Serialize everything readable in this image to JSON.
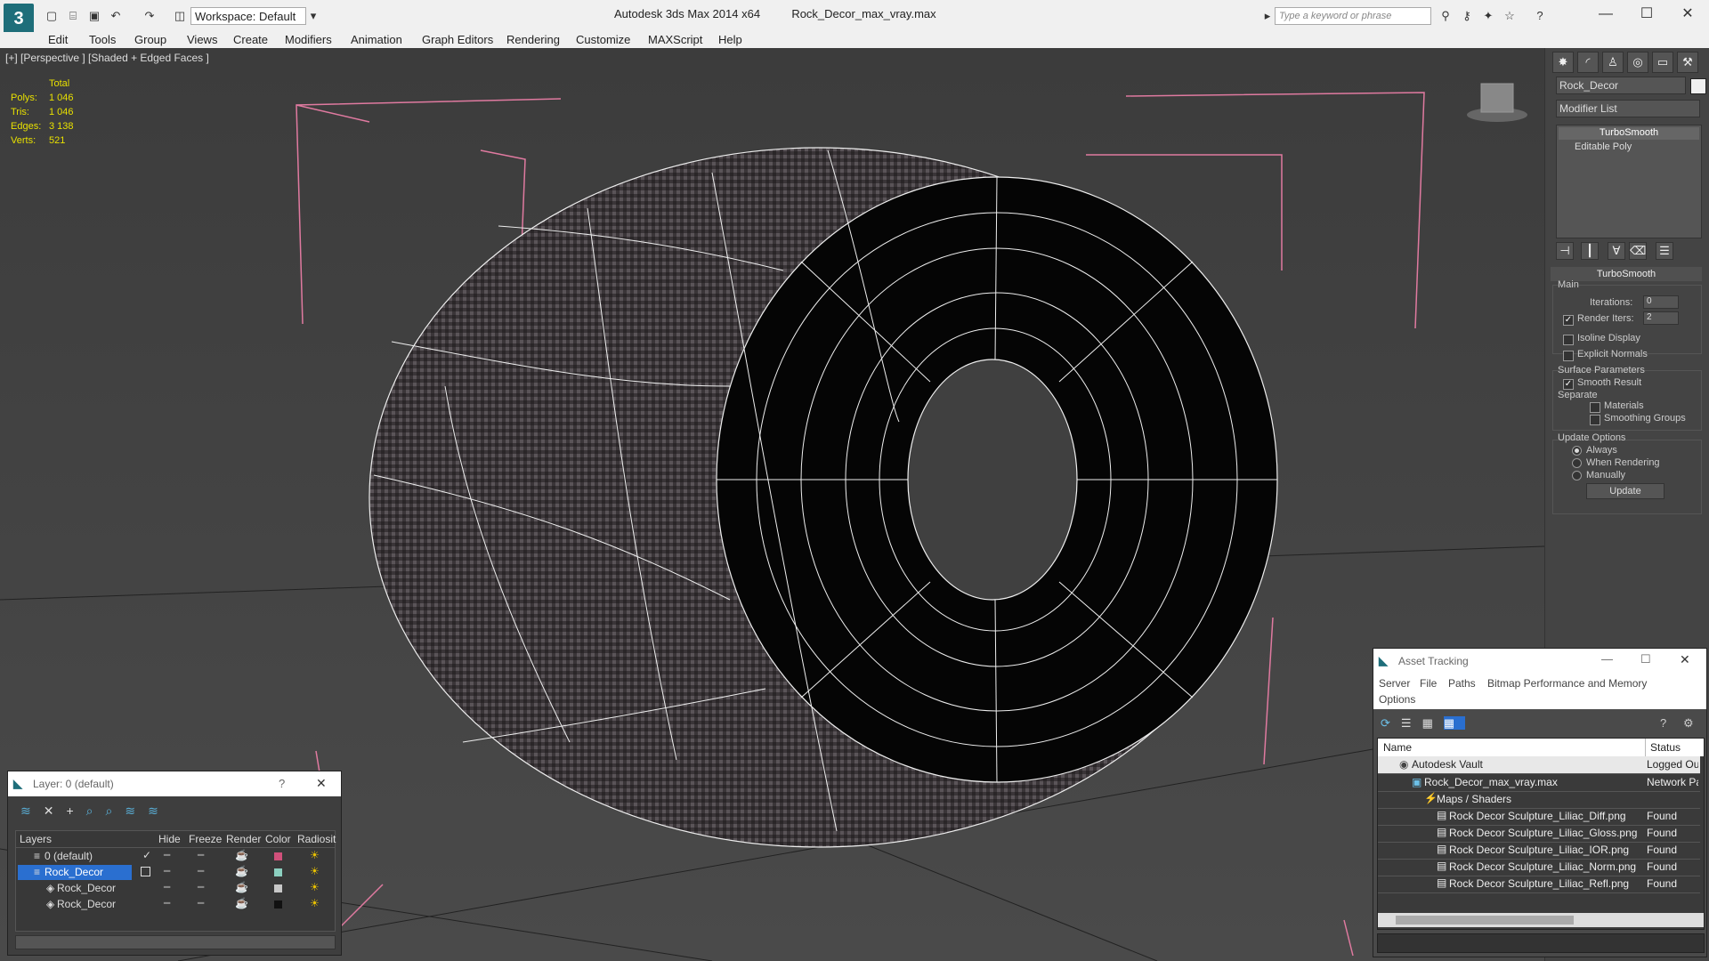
{
  "app": {
    "title_app": "Autodesk 3ds Max  2014 x64",
    "title_file": "Rock_Decor_max_vray.max",
    "workspace": "Workspace: Default",
    "search_placeholder": "Type a keyword or phrase"
  },
  "menu": [
    "Edit",
    "Tools",
    "Group",
    "Views",
    "Create",
    "Modifiers",
    "Animation",
    "Graph Editors",
    "Rendering",
    "Customize",
    "MAXScript",
    "Help"
  ],
  "viewport": {
    "label": "[+] [Perspective ] [Shaded + Edged Faces ]",
    "stats": {
      "header": "Total",
      "polys_label": "Polys:",
      "polys": "1 046",
      "tris_label": "Tris:",
      "tris": "1 046",
      "edges_label": "Edges:",
      "edges": "3 138",
      "verts_label": "Verts:",
      "verts": "521"
    }
  },
  "command_panel": {
    "object_name": "Rock_Decor",
    "modifier_list": "Modifier List",
    "stack": [
      "TurboSmooth",
      "Editable Poly"
    ],
    "rollout_title": "TurboSmooth",
    "main_label": "Main",
    "iterations_label": "Iterations:",
    "iterations": "0",
    "render_iters_label": "Render Iters:",
    "render_iters": "2",
    "isoline": "Isoline Display",
    "explicit_normals": "Explicit Normals",
    "surface_params": "Surface Parameters",
    "smooth_result": "Smooth Result",
    "separate": "Separate",
    "materials": "Materials",
    "smoothing_groups": "Smoothing Groups",
    "update_options": "Update Options",
    "always": "Always",
    "when_rendering": "When Rendering",
    "manually": "Manually",
    "update_button": "Update",
    "render_iters_checked": true,
    "smooth_result_checked": true,
    "update_selected": "Always"
  },
  "layer_window": {
    "title": "Layer: 0 (default)",
    "help": "?",
    "columns": [
      "Layers",
      "Hide",
      "Freeze",
      "Render",
      "Color",
      "Radiosit"
    ],
    "rows": [
      {
        "name": "0 (default)",
        "color": "#d0507a",
        "checked": true
      },
      {
        "name": "Rock_Decor",
        "color": "#8cd0c0",
        "selected": true
      },
      {
        "name": "Rock_Decor",
        "color": "#c8c8c8"
      },
      {
        "name": "Rock_Decor",
        "color": "#111111"
      }
    ]
  },
  "asset_window": {
    "title": "Asset Tracking",
    "menu": [
      "Server",
      "File",
      "Paths",
      "Bitmap Performance and Memory",
      "Options"
    ],
    "col_name": "Name",
    "col_status": "Status",
    "rows": [
      {
        "name": "Autodesk Vault",
        "status": "Logged Out"
      },
      {
        "name": "Rock_Decor_max_vray.max",
        "status": "Network Path"
      },
      {
        "name": "Maps / Shaders",
        "status": ""
      },
      {
        "name": "Rock Decor Sculpture_Liliac_Diff.png",
        "status": "Found"
      },
      {
        "name": "Rock Decor Sculpture_Liliac_Gloss.png",
        "status": "Found"
      },
      {
        "name": "Rock Decor Sculpture_Liliac_IOR.png",
        "status": "Found"
      },
      {
        "name": "Rock Decor Sculpture_Liliac_Norm.png",
        "status": "Found"
      },
      {
        "name": "Rock Decor Sculpture_Liliac_Refl.png",
        "status": "Found"
      }
    ]
  }
}
